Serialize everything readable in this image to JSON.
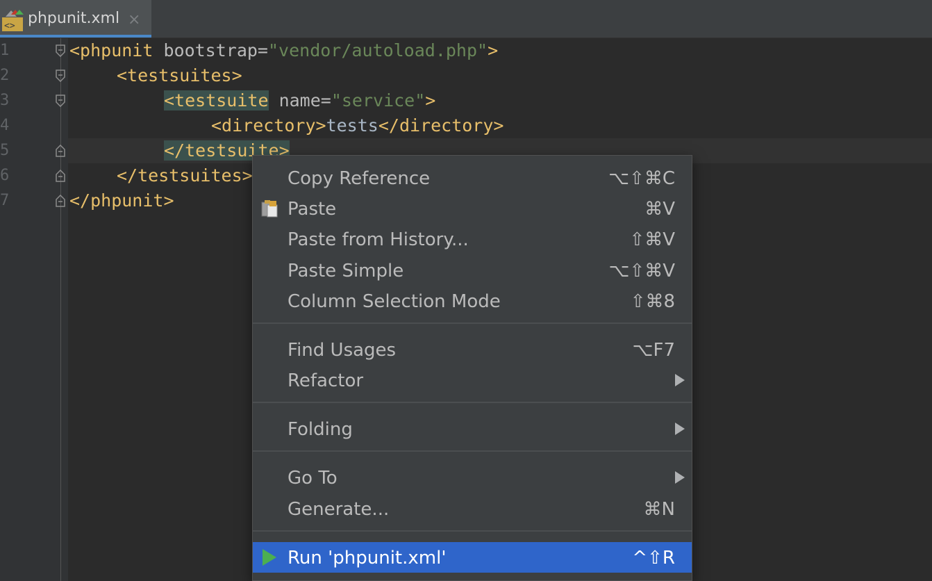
{
  "tab": {
    "label": "phpunit.xml",
    "close": "×"
  },
  "line_numbers": [
    "1",
    "2",
    "3",
    "4",
    "5",
    "6",
    "7"
  ],
  "code": {
    "l1": {
      "open": "<phpunit",
      "attr": " bootstrap=",
      "val": "\"vendor/autoload.php\"",
      "close": ">"
    },
    "l2": {
      "text": "<testsuites>"
    },
    "l3": {
      "open": "<testsuite",
      "attr": " name=",
      "val": "\"service\"",
      "close": ">"
    },
    "l4": {
      "open": "<directory>",
      "text": "tests",
      "close": "</directory>"
    },
    "l5": {
      "text": "</testsuite>"
    },
    "l6": {
      "text": "</testsuites>"
    },
    "l7": {
      "text": "</phpunit>"
    }
  },
  "menu": {
    "copy_reference": {
      "label": "Copy Reference",
      "shortcut": "⌥⇧⌘C"
    },
    "paste": {
      "label": "Paste",
      "shortcut": "⌘V",
      "icon": "clipboard-icon"
    },
    "paste_history": {
      "label": "Paste from History...",
      "shortcut": "⇧⌘V"
    },
    "paste_simple": {
      "label": "Paste Simple",
      "shortcut": "⌥⇧⌘V"
    },
    "column_selection": {
      "label": "Column Selection Mode",
      "shortcut": "⇧⌘8"
    },
    "find_usages": {
      "label": "Find Usages",
      "shortcut": "⌥F7"
    },
    "refactor": {
      "label": "Refactor"
    },
    "folding": {
      "label": "Folding"
    },
    "go_to": {
      "label": "Go To"
    },
    "generate": {
      "label": "Generate...",
      "shortcut": "⌘N"
    },
    "run": {
      "label": "Run 'phpunit.xml'",
      "shortcut": "^⇧R",
      "icon": "run-play-icon"
    }
  },
  "colors": {
    "editor_bg": "#2b2b2b",
    "tag": "#e8bf6a",
    "string": "#6a8759",
    "menu_bg": "#3c3f41",
    "selection": "#2f65ca"
  }
}
